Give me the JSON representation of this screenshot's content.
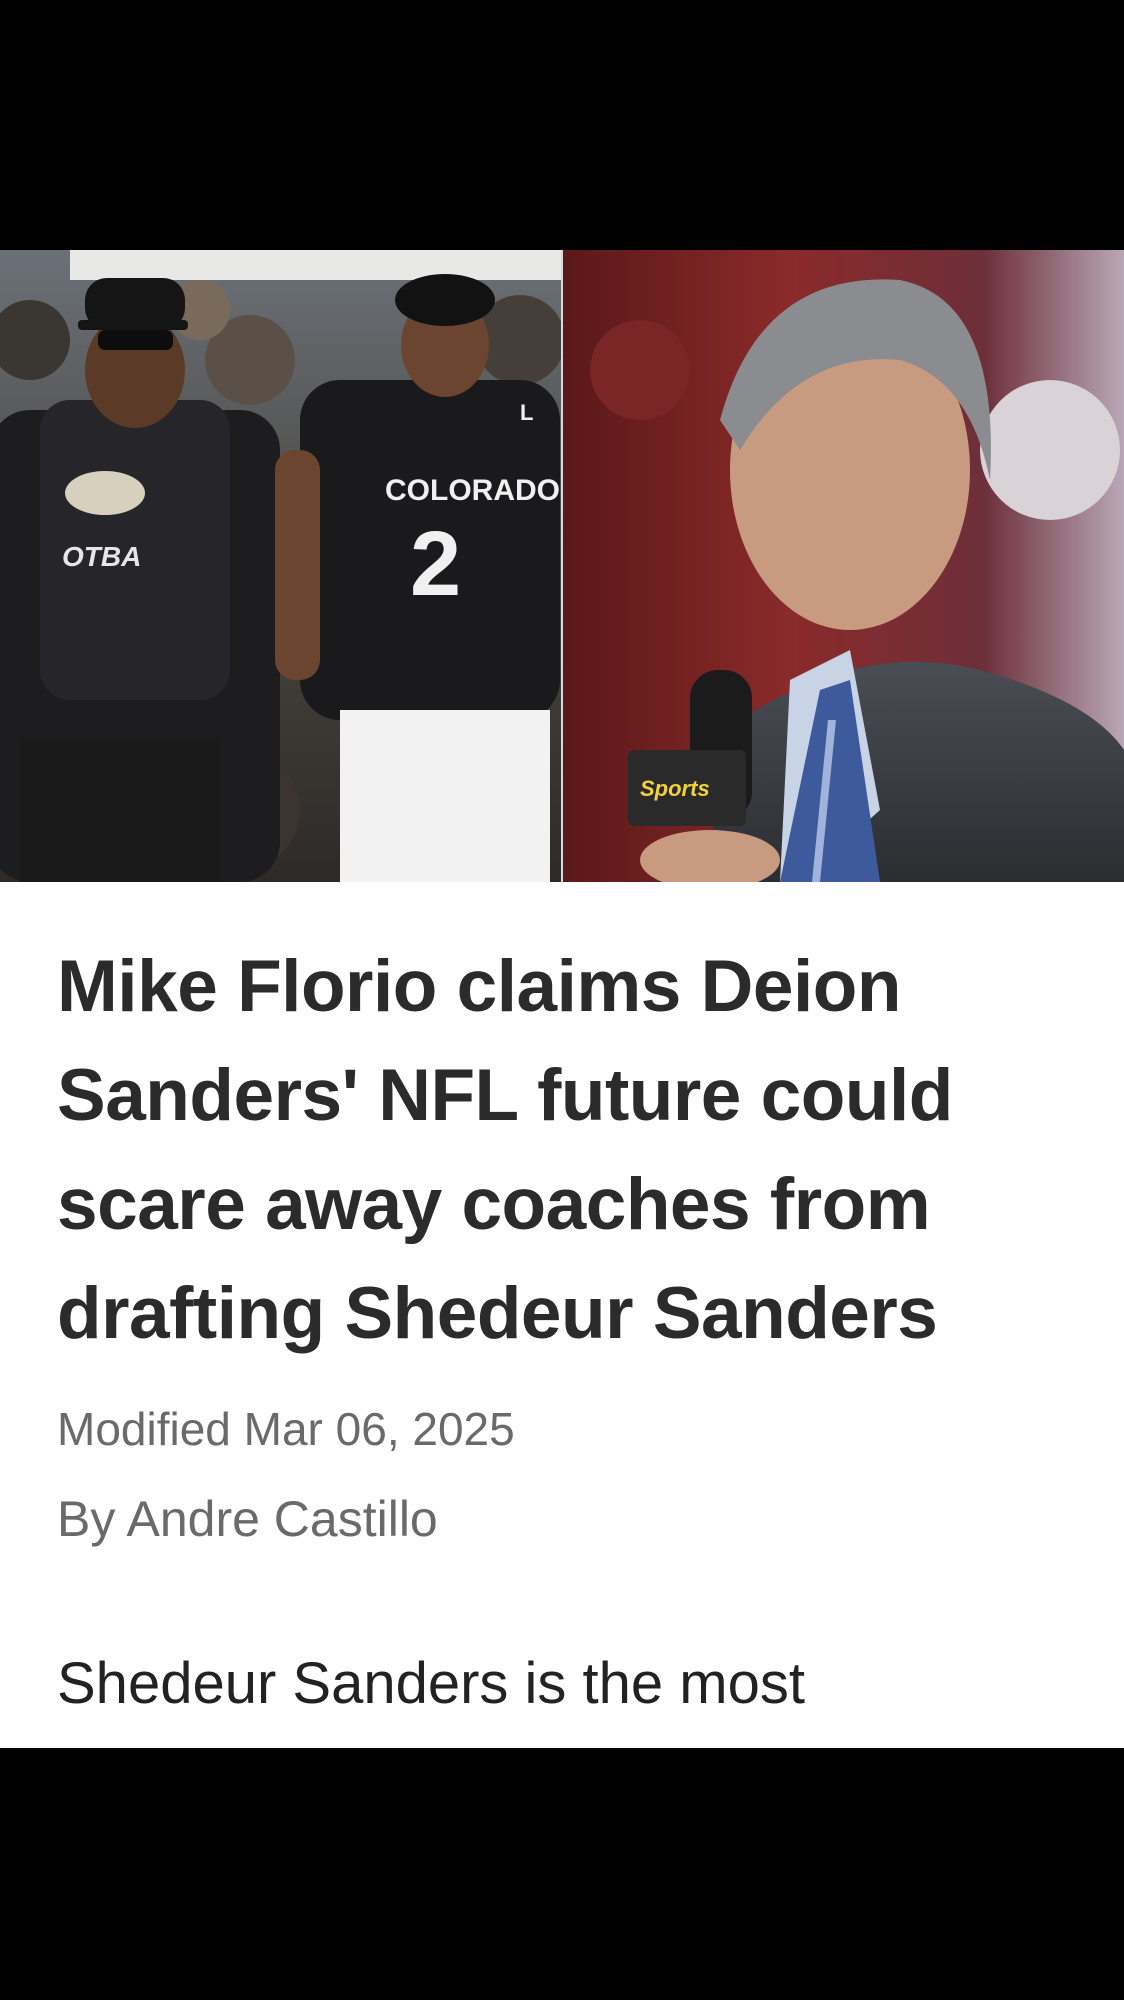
{
  "article": {
    "headline": "Mike Florio claims Deion Sanders' NFL future could scare away coaches from drafting Shedeur Sanders",
    "modified": "Modified Mar 06, 2025",
    "author": "By Andre Castillo",
    "body_text": "Shedeur Sanders is the most"
  },
  "hero_image": {
    "left_panel": {
      "jersey_text": "COLORADO",
      "jersey_number": "2",
      "hoodie_text": "OTBA",
      "sleeve_letter": "L"
    },
    "right_panel": {
      "mic_flag_text": "Sports"
    }
  },
  "colors": {
    "headline": "#2b2b2b",
    "meta": "#6a6a6a",
    "body": "#222222",
    "background": "#ffffff",
    "letterbox": "#000000"
  }
}
